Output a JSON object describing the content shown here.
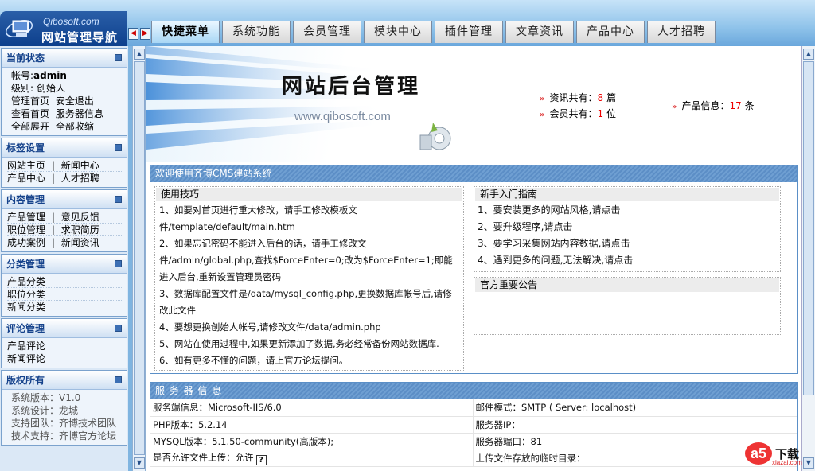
{
  "header": {
    "logo_small": "Qibosoft.com",
    "logo_main": "网站管理导航",
    "arrow_left": "◀",
    "arrow_right": "▶",
    "tabs": [
      {
        "label": "快捷菜单",
        "active": true
      },
      {
        "label": "系统功能"
      },
      {
        "label": "会员管理"
      },
      {
        "label": "模块中心"
      },
      {
        "label": "插件管理"
      },
      {
        "label": "文章资讯"
      },
      {
        "label": "产品中心"
      },
      {
        "label": "人才招聘"
      }
    ]
  },
  "sidebar": {
    "status": {
      "title": "当前状态",
      "account_label": "帐号:",
      "account_value": "admin",
      "level_label": "级别:",
      "level_value": "创始人",
      "links": [
        [
          "管理首页",
          "安全退出"
        ],
        [
          "查看首页",
          "服务器信息"
        ],
        [
          "全部展开",
          "全部收缩"
        ]
      ]
    },
    "tags": {
      "title": "标签设置",
      "rows": [
        [
          "网站主页",
          "新闻中心"
        ],
        [
          "产品中心",
          "人才招聘"
        ]
      ]
    },
    "content": {
      "title": "内容管理",
      "rows": [
        [
          "产品管理",
          "意见反馈"
        ],
        [
          "职位管理",
          "求职简历"
        ],
        [
          "成功案例",
          "新闻资讯"
        ]
      ]
    },
    "category": {
      "title": "分类管理",
      "rows": [
        "产品分类",
        "职位分类",
        "新闻分类"
      ]
    },
    "comment": {
      "title": "评论管理",
      "rows": [
        "产品评论",
        "新闻评论"
      ]
    },
    "copyright": {
      "title": "版权所有",
      "rows": [
        "系统版本：V1.0",
        "系统设计：龙城",
        "支持团队：齐博技术团队",
        "技术支持：齐博官方论坛"
      ]
    },
    "separator": "|"
  },
  "banner": {
    "title": "网站后台管理",
    "url": "www.qibosoft.com",
    "marker": "»",
    "stats": {
      "news_label": "资讯共有：",
      "news_count": "8",
      "news_unit": " 篇",
      "member_label": "会员共有：",
      "member_count": "1",
      "member_unit": " 位",
      "product_label": "产品信息：",
      "product_count": "17",
      "product_unit": " 条"
    }
  },
  "welcome": {
    "title": "欢迎使用齐博CMS建站系统",
    "tips_title": "使用技巧",
    "tips": [
      "1、如要对首页进行重大修改，请手工修改模板文件/template/default/main.htm",
      "2、如果忘记密码不能进入后台的话，请手工修改文件/admin/global.php,查找$ForceEnter=0;改为$ForceEnter=1;即能进入后台,重新设置管理员密码",
      "3、数据库配置文件是/data/mysql_config.php,更换数据库帐号后,请修改此文件",
      "4、要想更换创始人帐号,请修改文件/data/admin.php",
      "5、网站在使用过程中,如果更新添加了数据,务必经常备份网站数据库.",
      "6、如有更多不懂的问题，请上官方论坛提问。"
    ],
    "guide_title": "新手入门指南",
    "guide": [
      "1、要安装更多的网站风格,请点击",
      "2、要升级程序,请点击",
      "3、要学习采集网站内容数据,请点击",
      "4、遇到更多的问题,无法解决,请点击"
    ],
    "notice_title": "官方重要公告"
  },
  "server": {
    "title": "服 务 器 信 息",
    "rows": [
      [
        "服务端信息：Microsoft-IIS/6.0",
        "邮件模式：SMTP ( Server: localhost)"
      ],
      [
        "PHP版本：5.2.14",
        "服务器IP："
      ],
      [
        "MYSQL版本：5.1.50-community(高版本);",
        "服务器端口：81"
      ],
      [
        "是否允许文件上传：允许",
        "上传文件存放的临时目录："
      ]
    ],
    "help_icon": "?"
  },
  "watermark": {
    "logo": "a5",
    "text": "下载",
    "small": "xiazai.com"
  },
  "colors": {
    "accent": "#15428b",
    "header_bg": "#8fc3ea",
    "box_head": "#6f9fd2",
    "stat_number": "#e00000"
  }
}
